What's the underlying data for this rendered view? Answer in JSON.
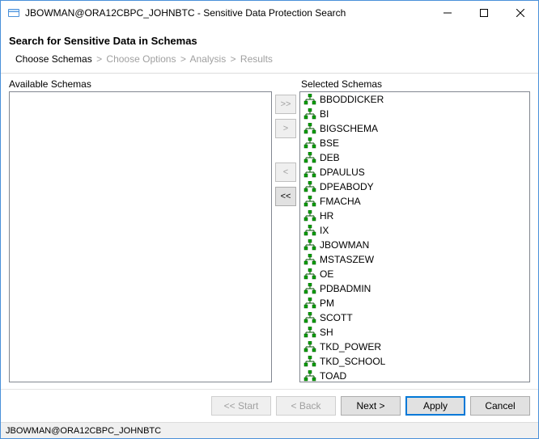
{
  "window": {
    "title": "JBOWMAN@ORA12CBPC_JOHNBTC - Sensitive Data Protection Search"
  },
  "subtitle": "Search for Sensitive Data in Schemas",
  "breadcrumb": {
    "items": [
      {
        "label": "Choose Schemas",
        "active": true
      },
      {
        "label": "Choose Options",
        "active": false
      },
      {
        "label": "Analysis",
        "active": false
      },
      {
        "label": "Results",
        "active": false
      }
    ],
    "sep": ">"
  },
  "labels": {
    "available": "Available Schemas",
    "selected": "Selected Schemas"
  },
  "transfer": {
    "add_all": ">>",
    "add_one": ">",
    "remove_one": "<",
    "remove_all": "<<"
  },
  "schemas": {
    "available": [],
    "selected": [
      "BBODDICKER",
      "BI",
      "BIGSCHEMA",
      "BSE",
      "DEB",
      "DPAULUS",
      "DPEABODY",
      "FMACHA",
      "HR",
      "IX",
      "JBOWMAN",
      "MSTASZEW",
      "OE",
      "PDBADMIN",
      "PM",
      "SCOTT",
      "SH",
      "TKD_POWER",
      "TKD_SCHOOL",
      "TOAD"
    ]
  },
  "buttons": {
    "start": "<< Start",
    "back": "< Back",
    "next": "Next >",
    "apply": "Apply",
    "cancel": "Cancel"
  },
  "status": "JBOWMAN@ORA12CBPC_JOHNBTC"
}
